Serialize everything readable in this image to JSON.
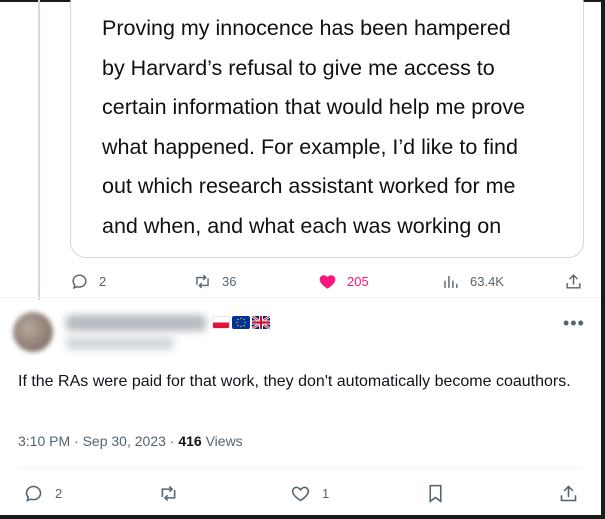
{
  "quoted_post": {
    "lines": [
      "Proving my innocence has been hampered",
      "by Harvard’s refusal to give me access to",
      "certain information that would help me prove",
      "what happened. For example, I’d like to find",
      "out which research assistant worked for me",
      "and when, and what each was working on"
    ]
  },
  "parent_actions": {
    "replies": "2",
    "reposts": "36",
    "likes": "205",
    "views": "63.4K"
  },
  "reply": {
    "text": "If the RAs were paid for that work, they don't automatically become coauthors.",
    "time": "3:10 PM",
    "separator1": "·",
    "date": "Sep 30, 2023",
    "separator2": "·",
    "views_count": "416",
    "views_label": "Views"
  },
  "reply_actions": {
    "replies": "2",
    "likes": "1"
  },
  "icons": {
    "reply": "reply-icon",
    "repost": "repost-icon",
    "like": "heart-icon",
    "views": "analytics-icon",
    "share": "share-icon",
    "bookmark": "bookmark-icon",
    "more": "more-icon"
  },
  "colors": {
    "like_active": "#f91880",
    "muted": "#536471",
    "text": "#0f1419",
    "border": "#cfd9de"
  }
}
